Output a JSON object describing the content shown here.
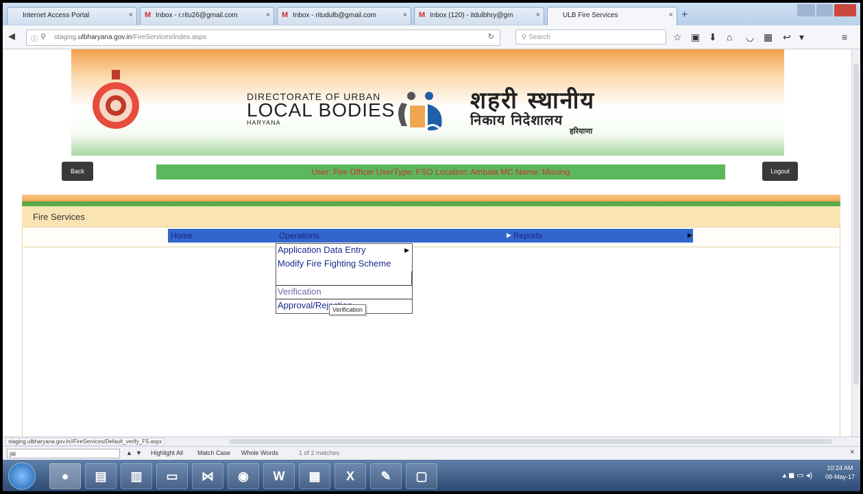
{
  "browser": {
    "tabs": [
      {
        "label": "Internet Access Portal",
        "icon": "page-icon"
      },
      {
        "label": "Inbox - r.ritu26@gmail.com",
        "icon": "gmail-icon"
      },
      {
        "label": "Inbox - ritudulb@gmail.com",
        "icon": "gmail-icon"
      },
      {
        "label": "Inbox (120) - itdulbhry@gm",
        "icon": "gmail-icon"
      },
      {
        "label": "ULB Fire Services",
        "icon": "page-icon"
      }
    ],
    "url_prefix": "staging.",
    "url_domain": "ulbharyana.gov.in",
    "url_path": "/FireServices/index.aspx",
    "search_placeholder": "Search"
  },
  "header": {
    "dept_line1": "DIRECTORATE OF URBAN",
    "dept_line2": "LOCAL BODIES",
    "dept_line3": "HARYANA",
    "hindi_line1": "शहरी स्थानीय",
    "hindi_line2": "निकाय निदेशालय",
    "hindi_line3": "हरियाणा"
  },
  "toolbar": {
    "back_label": "Back",
    "logout_label": "Logout",
    "user_info": "User: Fire Officer   UserType: FSO   Location: Ambala   MC Name: Missing"
  },
  "panel": {
    "title": "Fire Services"
  },
  "menu": {
    "home": "Home",
    "operations": "Operations",
    "reports": "Reports",
    "dropdown": [
      "Application Data Entry",
      "Modify Fire Fighting Scheme",
      "",
      "Verification",
      "Approval/Rejection"
    ],
    "tooltip": "Verification"
  },
  "status": {
    "link_url": "staging.ulbharyana.gov.in//FireServices/Default_verify_FS.aspx"
  },
  "findbar": {
    "query": "jai",
    "highlight_all": "Highlight All",
    "match_case": "Match Case",
    "whole_words": "Whole Words",
    "result": "1 of 2 matches"
  },
  "taskbar": {
    "time": "10:24 AM",
    "date": "08-May-17"
  },
  "colors": {
    "menubar": "#3366cc",
    "userbar": "#5cb85c",
    "userbar_text": "#c9302c",
    "panel_head": "#fbe4b3"
  }
}
